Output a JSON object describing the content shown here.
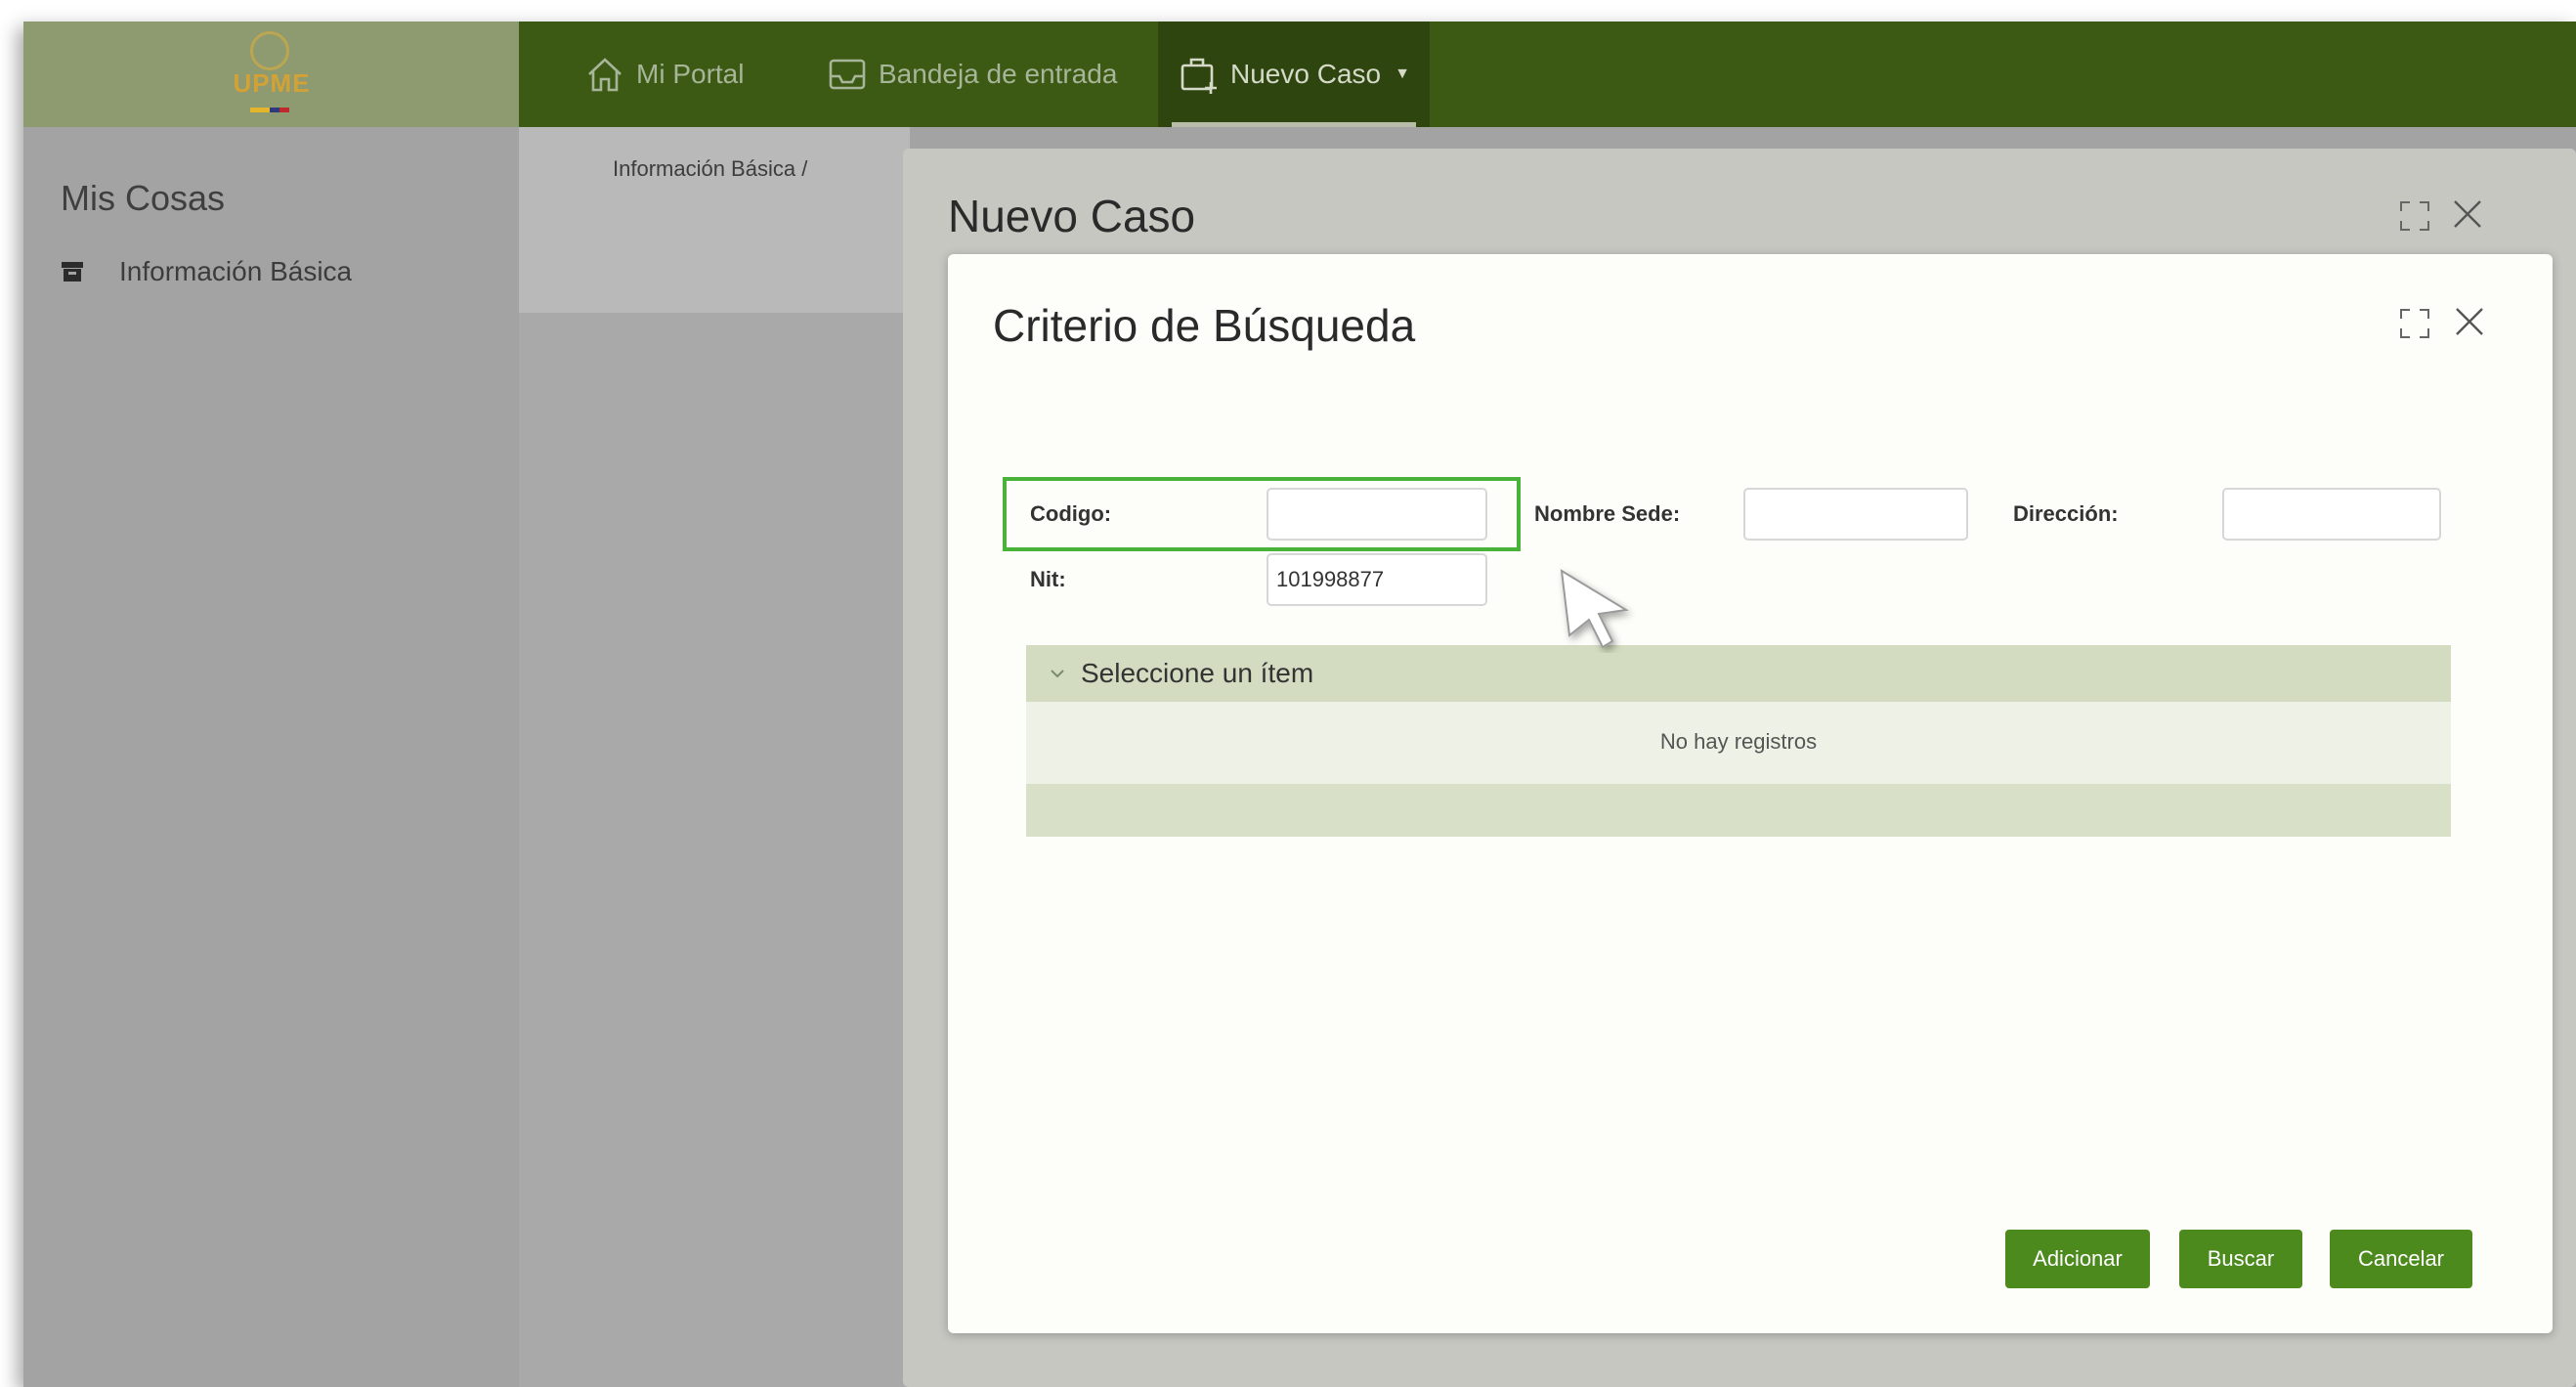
{
  "app": {
    "logo_text": "UPME",
    "colors": {
      "nav_bg": "#3d5a14",
      "nav_active": "#2e4510",
      "button": "#4d8a1e",
      "highlight": "#49b239"
    }
  },
  "nav": {
    "items": [
      {
        "label": "Mi Portal",
        "icon": "home-icon"
      },
      {
        "label": "Bandeja de entrada",
        "icon": "inbox-icon"
      },
      {
        "label": "Nuevo Caso",
        "icon": "briefcase-add-icon",
        "active": true,
        "has_dropdown": true
      }
    ]
  },
  "sidebar": {
    "title": "Mis Cosas",
    "items": [
      {
        "label": "Información Básica",
        "icon": "archive-icon"
      }
    ]
  },
  "main": {
    "breadcrumb": "Información Básica /"
  },
  "outer_modal": {
    "title": "Nuevo Caso"
  },
  "search_dialog": {
    "title": "Criterio de Búsqueda",
    "fields": {
      "codigo": {
        "label": "Codigo:",
        "value": ""
      },
      "nombre_sede": {
        "label": "Nombre Sede:",
        "value": ""
      },
      "direccion": {
        "label": "Dirección:",
        "value": ""
      },
      "nit": {
        "label": "Nit:",
        "value": "101998877"
      }
    },
    "grid": {
      "header": "Seleccione un ítem",
      "empty_text": "No hay registros"
    },
    "buttons": {
      "add": "Adicionar",
      "search": "Buscar",
      "cancel": "Cancelar"
    }
  }
}
